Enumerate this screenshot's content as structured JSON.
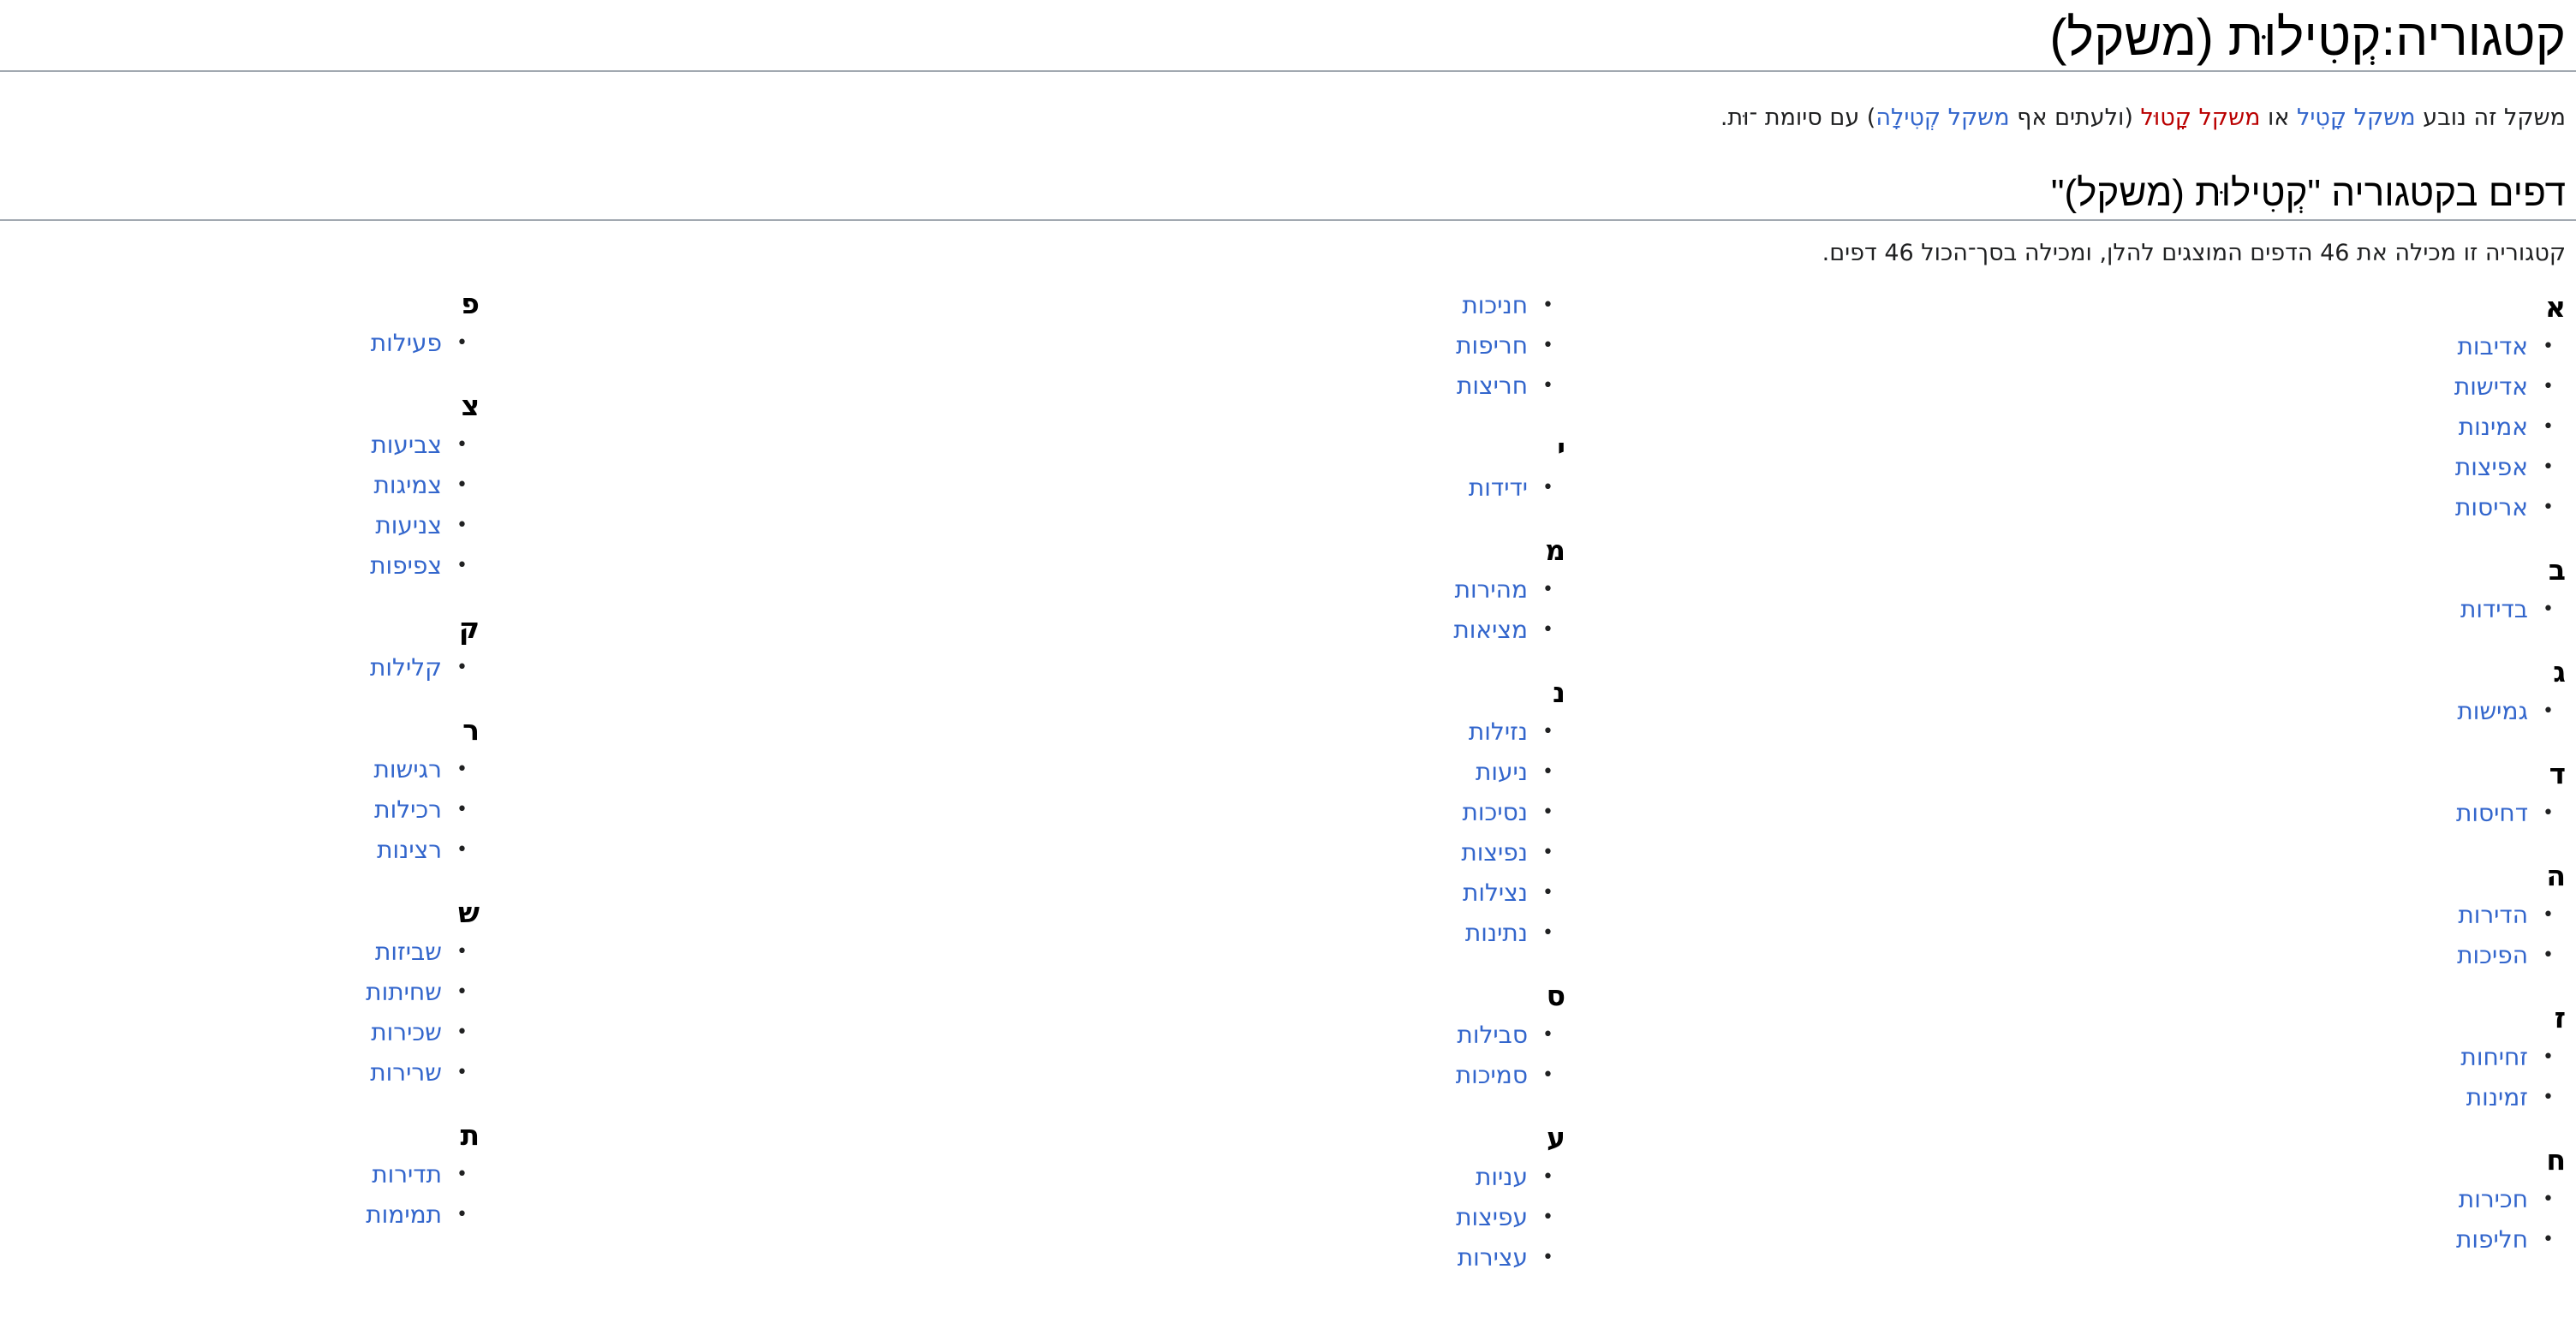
{
  "title": "קטגוריה:קְטִילוּת (משקל)",
  "intro": {
    "part1": "משקל זה נובע ",
    "link1": "משקל קָטִיל",
    "part2": " או ",
    "link2": "משקל קָטוּל",
    "part3": " (ולעתים אף ",
    "link3": "משקל קְטִילָה",
    "part4": ") עם סיומת ־וּת."
  },
  "pages_heading": "דפים בקטגוריה \"קְטִילוּת (משקל)\"",
  "count_text": "קטגוריה זו מכילה את 46 הדפים המוצגים להלן, ומכילה בסך־הכול 46 דפים.",
  "bullet": "•",
  "colors": {
    "link": "#3366cc",
    "new_link": "#ba0000",
    "rule": "#a2a9b1",
    "text": "#202122"
  },
  "columns": [
    {
      "groups": [
        {
          "letter": "א",
          "items": [
            "אדיבות",
            "אדישות",
            "אמינות",
            "אפיצות",
            "אריסות"
          ]
        },
        {
          "letter": "ב",
          "items": [
            "בדידות"
          ]
        },
        {
          "letter": "ג",
          "items": [
            "גמישות"
          ]
        },
        {
          "letter": "ד",
          "items": [
            "דחיסות"
          ]
        },
        {
          "letter": "ה",
          "items": [
            "הדירות",
            "הפיכות"
          ]
        },
        {
          "letter": "ז",
          "items": [
            "זחיחות",
            "זמינות"
          ]
        },
        {
          "letter": "ח",
          "items": [
            "חכירות",
            "חליפות"
          ]
        }
      ]
    },
    {
      "continuation": [
        "חניכות",
        "חריפות",
        "חריצות"
      ],
      "groups": [
        {
          "letter": "י",
          "items": [
            "ידידות"
          ]
        },
        {
          "letter": "מ",
          "items": [
            "מהירות",
            "מציאות"
          ]
        },
        {
          "letter": "נ",
          "items": [
            "נזילות",
            "ניעות",
            "נסיכות",
            "נפיצות",
            "נצילות",
            "נתינות"
          ]
        },
        {
          "letter": "ס",
          "items": [
            "סבילות",
            "סמיכות"
          ]
        },
        {
          "letter": "ע",
          "items": [
            "עניות",
            "עפיצות",
            "עצירות"
          ]
        }
      ]
    },
    {
      "groups": [
        {
          "letter": "פ",
          "items": [
            "פעילות"
          ]
        },
        {
          "letter": "צ",
          "items": [
            "צביעות",
            "צמיגות",
            "צניעות",
            "צפיפות"
          ]
        },
        {
          "letter": "ק",
          "items": [
            "קלילות"
          ]
        },
        {
          "letter": "ר",
          "items": [
            "רגישות",
            "רכילות",
            "רצינות"
          ]
        },
        {
          "letter": "ש",
          "items": [
            "שביזות",
            "שחיתות",
            "שכירות",
            "שרירות"
          ]
        },
        {
          "letter": "ת",
          "items": [
            "תדירות",
            "תמימות"
          ]
        }
      ]
    }
  ]
}
